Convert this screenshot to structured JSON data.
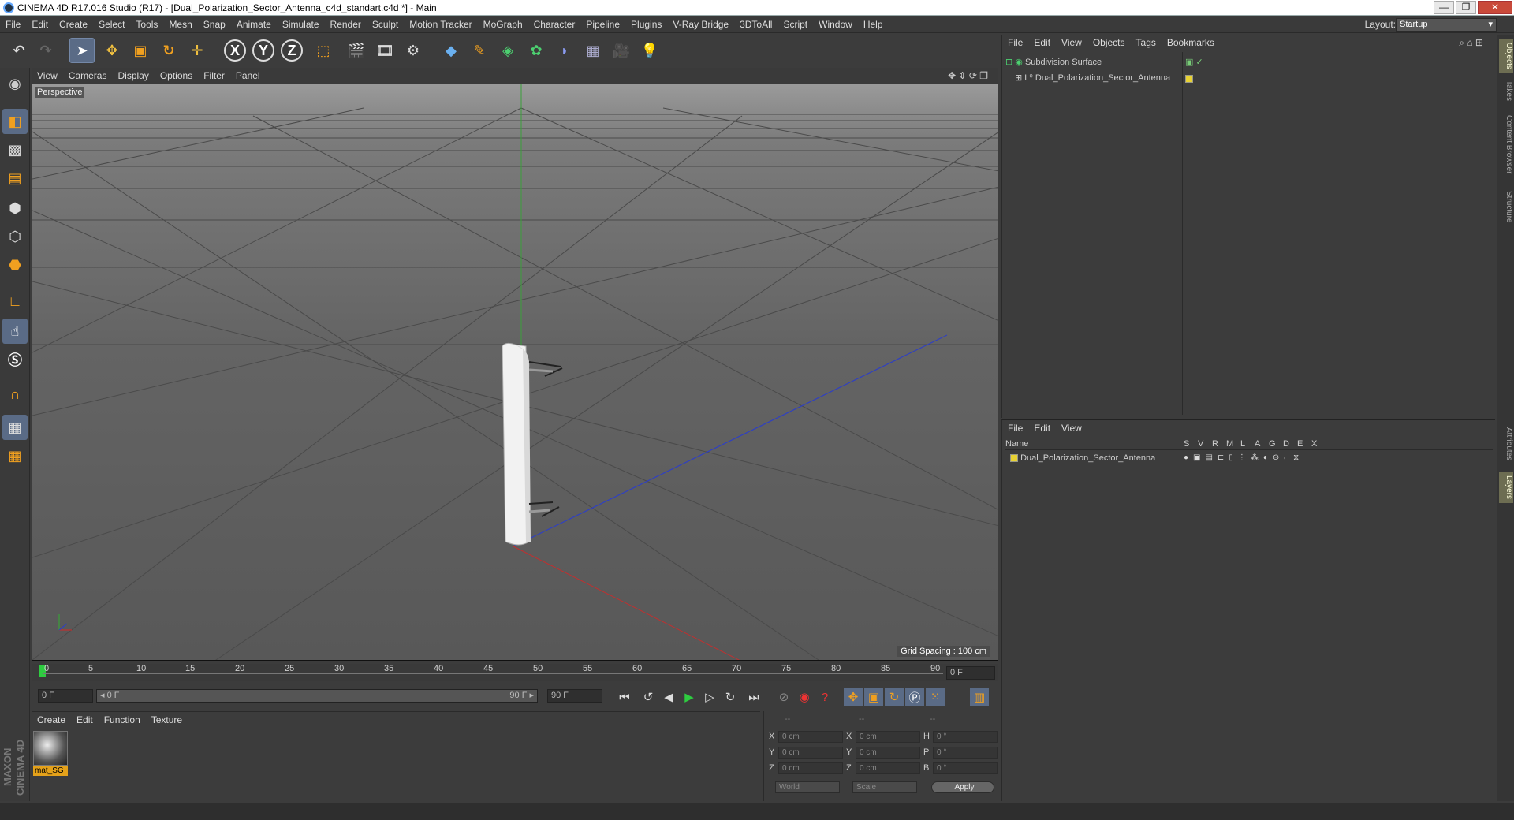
{
  "window": {
    "title": "CINEMA 4D R17.016 Studio (R17) - [Dual_Polarization_Sector_Antenna_c4d_standart.c4d *] - Main",
    "min": "—",
    "max": "❐",
    "close": "✕"
  },
  "menubar": [
    "File",
    "Edit",
    "Create",
    "Select",
    "Tools",
    "Mesh",
    "Snap",
    "Animate",
    "Simulate",
    "Render",
    "Sculpt",
    "Motion Tracker",
    "MoGraph",
    "Character",
    "Pipeline",
    "Plugins",
    "V-Ray Bridge",
    "3DToAll",
    "Script",
    "Window",
    "Help"
  ],
  "layout": {
    "label": "Layout:",
    "value": "Startup"
  },
  "viewport": {
    "menu": [
      "View",
      "Cameras",
      "Display",
      "Options",
      "Filter",
      "Panel"
    ],
    "label": "Perspective",
    "grid_spacing": "Grid Spacing : 100 cm"
  },
  "timeline": {
    "ticks": [
      "0",
      "5",
      "10",
      "15",
      "20",
      "25",
      "30",
      "35",
      "40",
      "45",
      "50",
      "55",
      "60",
      "65",
      "70",
      "75",
      "80",
      "85",
      "90"
    ],
    "frame_end_field": "0 F"
  },
  "transport": {
    "start": "0 F",
    "range_start": "◂ 0 F",
    "range_end": "90 F ▸",
    "end": "90 F"
  },
  "materials": {
    "menu": [
      "Create",
      "Edit",
      "Function",
      "Texture"
    ],
    "items": [
      {
        "name": "mat_SG"
      }
    ]
  },
  "coords": {
    "header": [
      "--",
      "--",
      "--"
    ],
    "rows": [
      {
        "a": "X",
        "av": "0 cm",
        "b": "X",
        "bv": "0 cm",
        "c": "H",
        "cv": "0 °"
      },
      {
        "a": "Y",
        "av": "0 cm",
        "b": "Y",
        "bv": "0 cm",
        "c": "P",
        "cv": "0 °"
      },
      {
        "a": "Z",
        "av": "0 cm",
        "b": "Z",
        "bv": "0 cm",
        "c": "B",
        "cv": "0 °"
      }
    ],
    "world": "World",
    "scale": "Scale",
    "apply": "Apply"
  },
  "objects": {
    "menu": [
      "File",
      "Edit",
      "View",
      "Objects",
      "Tags",
      "Bookmarks"
    ],
    "items": [
      "Subdivision Surface",
      "Dual_Polarization_Sector_Antenna"
    ]
  },
  "layers": {
    "menu": [
      "File",
      "Edit",
      "View"
    ],
    "columns": [
      "Name",
      "S",
      "V",
      "R",
      "M",
      "L",
      "A",
      "G",
      "D",
      "E",
      "X"
    ],
    "items": [
      "Dual_Polarization_Sector_Antenna"
    ]
  },
  "righttabs": [
    "Objects",
    "Takes",
    "Content Browser",
    "Structure",
    "Attributes",
    "Layers"
  ],
  "branding": "MAXON CINEMA 4D",
  "colors": {
    "accent": "#5a6b86",
    "layer": "#e8d233",
    "material_tag": "#e5a21a"
  }
}
